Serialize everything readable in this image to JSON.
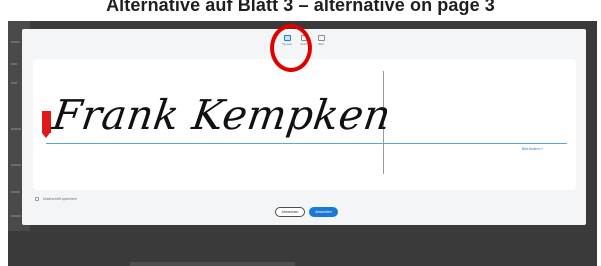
{
  "page_title": "Alternative auf Blatt 3 – alternative on page 3",
  "dialog": {
    "tabs": [
      {
        "label": "Tip-pen",
        "icon": "keyboard-icon",
        "active": true
      },
      {
        "label": "Zeich",
        "icon": "pen-draw-icon",
        "active": false
      },
      {
        "label": "Bild",
        "icon": "image-icon",
        "active": false
      }
    ],
    "signature_text": "Frank Kempken",
    "clear_link": "Bild ändern »",
    "save_checkbox_label": "Unterschrift speichern",
    "cancel_label": "Abbrechen",
    "apply_label": "Anwenden"
  },
  "colors": {
    "accent": "#1a78d6",
    "highlight": "#e00000",
    "marker": "#e01919",
    "backdrop": "#3a3a3a"
  }
}
